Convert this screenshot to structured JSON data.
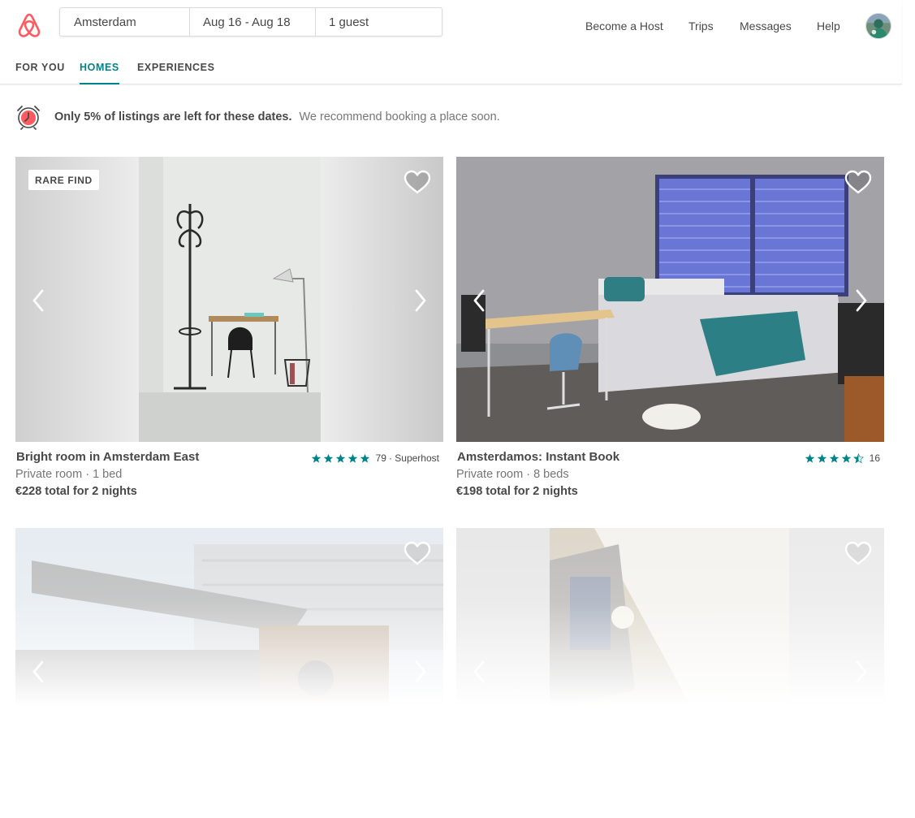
{
  "search": {
    "location": "Amsterdam",
    "dates": "Aug 16 - Aug 18",
    "guests": "1 guest"
  },
  "nav": {
    "become_host": "Become a Host",
    "trips": "Trips",
    "messages": "Messages",
    "help": "Help"
  },
  "tabs": [
    {
      "label": "FOR YOU",
      "active": false
    },
    {
      "label": "HOMES",
      "active": true
    },
    {
      "label": "EXPERIENCES",
      "active": false
    }
  ],
  "alert": {
    "strong": "Only 5% of listings are left for these dates.",
    "text": "We recommend booking a place soon."
  },
  "listings": [
    {
      "badge": "RARE FIND",
      "title": "Bright room in Amsterdam East",
      "subtitle": "Private room · 1 bed",
      "price": "€228 total for 2 nights",
      "stars": 5,
      "reviews": "79",
      "superhost": "· Superhost"
    },
    {
      "title": "Amsterdamos: Instant Book",
      "subtitle": "Private room · 8 beds",
      "price": "€198 total for 2 nights",
      "stars": 4.5,
      "reviews": "16"
    }
  ],
  "colors": {
    "brand": "#FF5A5F",
    "accent": "#008489",
    "text": "#484848",
    "muted": "#767676"
  },
  "icons": [
    "airbnb-logo-icon",
    "alarm-clock-icon",
    "heart-icon",
    "chevron-left-icon",
    "chevron-right-icon",
    "star-icon"
  ]
}
